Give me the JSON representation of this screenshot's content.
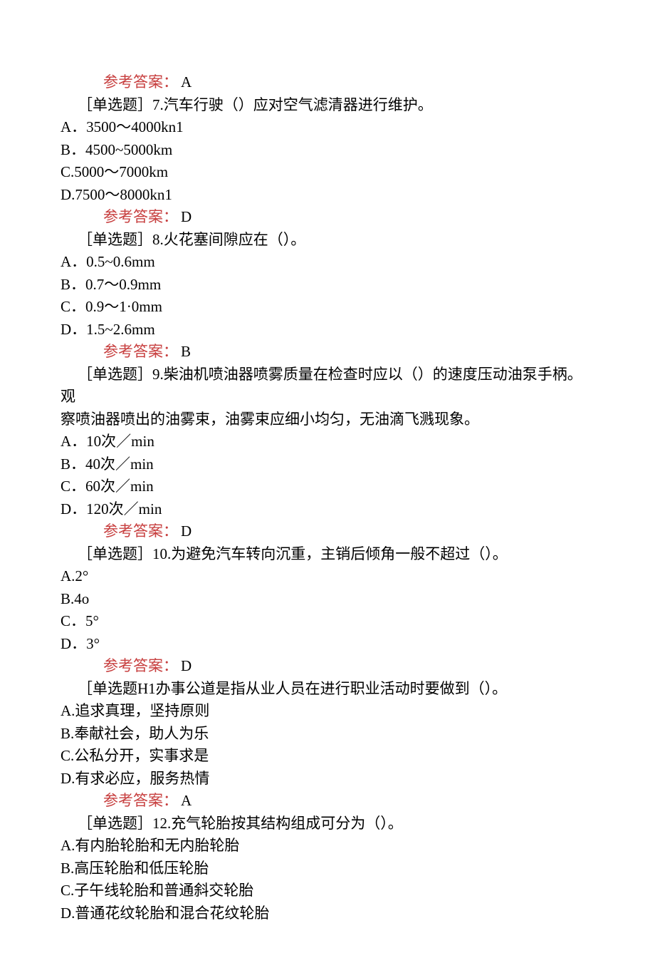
{
  "answer_label": "参考答案：",
  "answer_top": "A",
  "q7": {
    "question": "［单选题］7.汽车行驶（）应对空气滤清器进行维护。",
    "a": "A．3500～4000kn1",
    "b": "B．4500~5000km",
    "c": "C.5000～7000km",
    "d": "D.7500～8000kn1",
    "answer": "D"
  },
  "q8": {
    "question": "［单选题］8.火花塞间隙应在（）。",
    "a": "A．0.5~0.6mm",
    "b": "B．0.7～0.9mm",
    "c": "C．0.9～1·0mm",
    "d": "D．1.5~2.6mm",
    "answer": "B"
  },
  "q9": {
    "question_l1": "［单选题］9.柴油机喷油器喷雾质量在检查时应以（）的速度压动油泵手柄。观",
    "question_l2": "察喷油器喷出的油雾束，油雾束应细小均匀，无油滴飞溅现象。",
    "a": "A．10次／min",
    "b": "B．40次／min",
    "c": "C．60次／min",
    "d": "D．120次／min",
    "answer": "D"
  },
  "q10": {
    "question": "［单选题］10.为避免汽车转向沉重，主销后倾角一般不超过（）。",
    "a": "A.2°",
    "b": "B.4o",
    "c": "C．5°",
    "d": "D．3°",
    "answer": "D"
  },
  "q11": {
    "question": "［单选题H1办事公道是指从业人员在进行职业活动时要做到（）。",
    "a": "A.追求真理，坚持原则",
    "b": "B.奉献社会，助人为乐",
    "c": "C.公私分开，实事求是",
    "d": "D.有求必应，服务热情",
    "answer": "A"
  },
  "q12": {
    "question": "［单选题］12.充气轮胎按其结构组成可分为（）。",
    "a": "A.有内胎轮胎和无内胎轮胎",
    "b": "B.高压轮胎和低压轮胎",
    "c": "C.子午线轮胎和普通斜交轮胎",
    "d": "D.普通花纹轮胎和混合花纹轮胎"
  }
}
